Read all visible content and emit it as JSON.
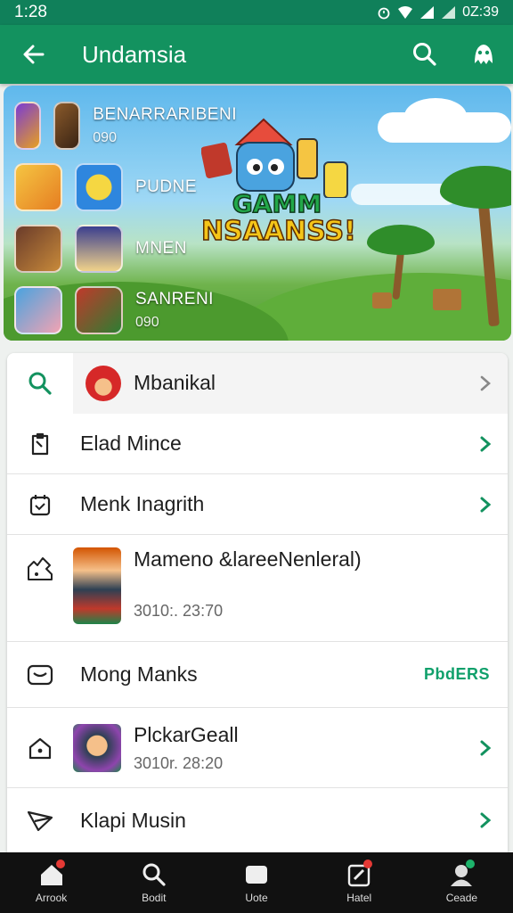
{
  "status_bar": {
    "time": "1:28",
    "battery_text": "0Z:39"
  },
  "app_bar": {
    "title": "Undamsia"
  },
  "banner": {
    "games": [
      {
        "name": "BENARRARIBENI",
        "score": "090",
        "colors": [
          "#7a3bd4",
          "#e8a020"
        ]
      },
      {
        "name": "PUDNE",
        "score": "",
        "colors": [
          "#f5c542",
          "#2e86de"
        ]
      },
      {
        "name": "MNEN",
        "score": "",
        "colors": [
          "#6a3b2a",
          "#f0d28a"
        ]
      },
      {
        "name": "SANRENI",
        "score": "090",
        "colors": [
          "#4aa3df",
          "#c0392b"
        ]
      }
    ],
    "logo_top": "GAMM",
    "logo_bottom": "NSAANSS!"
  },
  "list": {
    "items": [
      {
        "label": "Mbanikal",
        "icon": "search-icon"
      },
      {
        "label": "Elad Mince",
        "icon": "clipboard-icon"
      },
      {
        "label": "Menk Inagrith",
        "icon": "calendar-icon"
      },
      {
        "label": "Mameno &lareeNenleral)",
        "sub": "3010:. 23:70",
        "icon": "puzzle-icon"
      },
      {
        "label": "Mong Manks",
        "tag": "PbdERS",
        "icon": "mail-icon"
      },
      {
        "label": "PlckarGeall",
        "sub": "3010r. 28:20",
        "icon": "home-icon"
      },
      {
        "label": "Klapi Musin",
        "icon": "send-icon"
      }
    ]
  },
  "bottom_nav": {
    "items": [
      {
        "label": "Arrook",
        "icon": "home-icon"
      },
      {
        "label": "Bodit",
        "icon": "search-icon"
      },
      {
        "label": "Uote",
        "icon": "tray-icon"
      },
      {
        "label": "Hatel",
        "icon": "edit-icon"
      },
      {
        "label": "Ceade",
        "icon": "profile-icon"
      }
    ]
  },
  "colors": {
    "primary": "#13925f",
    "accent": "#10a06b",
    "badge": "#e53935"
  }
}
